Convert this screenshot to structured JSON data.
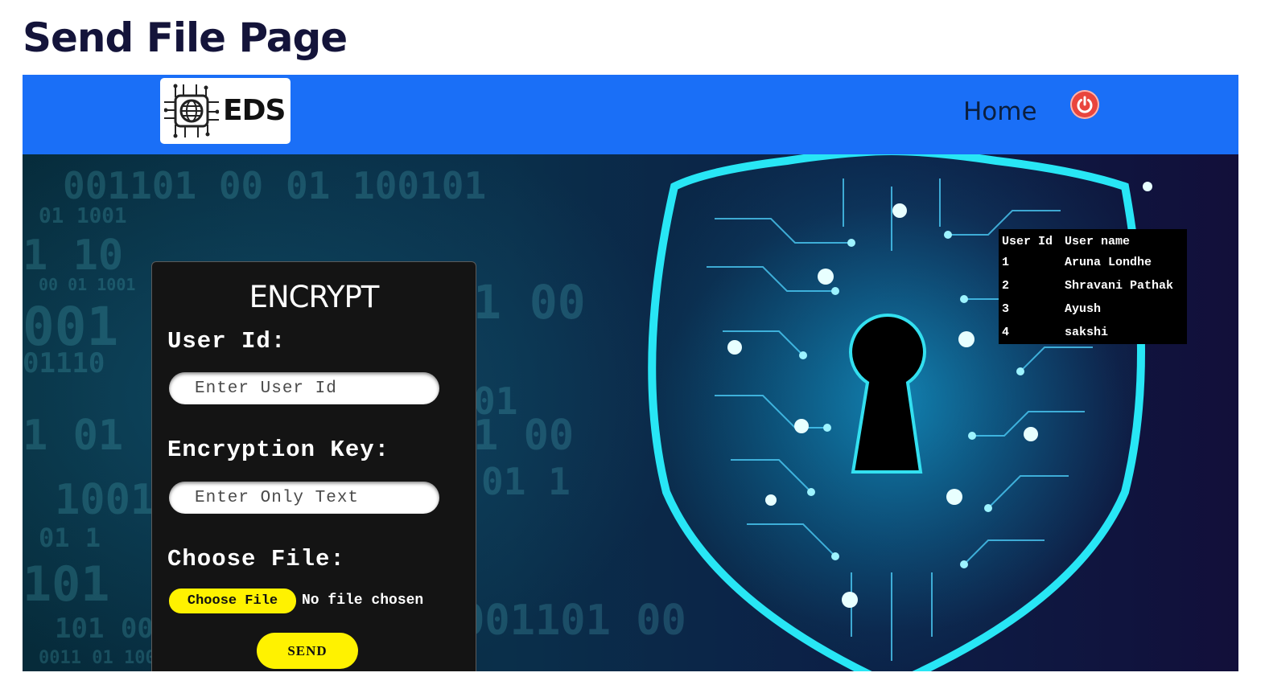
{
  "page": {
    "heading": "Send File Page"
  },
  "navbar": {
    "logo_text": "EDS",
    "home_label": "Home",
    "power_icon": "power-icon",
    "background_color": "#1a6ff7"
  },
  "form": {
    "title": "ENCRYPT",
    "user_id": {
      "label": "User Id:",
      "placeholder": "Enter User Id",
      "value": ""
    },
    "encryption_key": {
      "label": "Encryption Key:",
      "placeholder": "Enter Only Text",
      "value": ""
    },
    "file": {
      "label": "Choose File:",
      "button_label": "Choose File",
      "status": "No file chosen"
    },
    "send_label": "SEND",
    "accent_color": "#fff200"
  },
  "user_table": {
    "headers": [
      "User Id",
      "User name"
    ],
    "rows": [
      {
        "id": "1",
        "name": "Aruna Londhe"
      },
      {
        "id": "2",
        "name": "Shravani Pathak"
      },
      {
        "id": "3",
        "name": "Ayush"
      },
      {
        "id": "4",
        "name": "sakshi"
      }
    ]
  }
}
